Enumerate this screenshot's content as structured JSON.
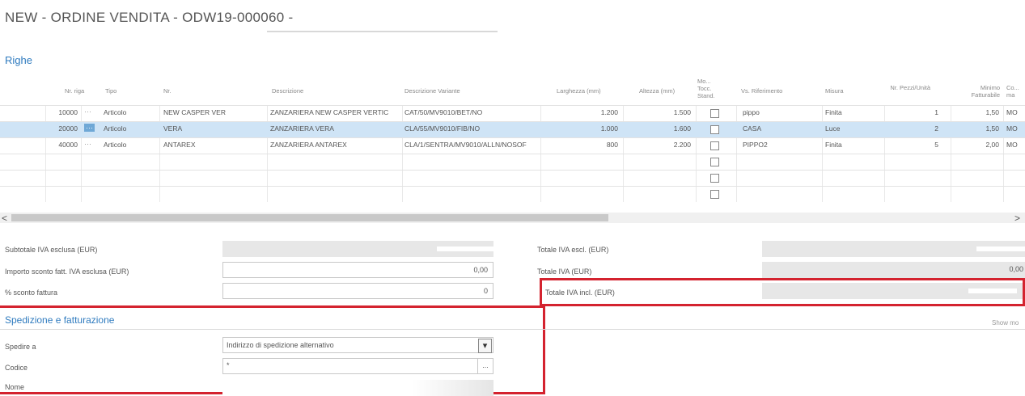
{
  "page_title": "NEW - ORDINE VENDITA - ODW19-000060 -",
  "section_righe": "Righe",
  "grid": {
    "headers": {
      "nr_riga": "Nr. riga",
      "tipo": "Tipo",
      "nr": "Nr.",
      "descrizione": "Descrizione",
      "descrizione_variante": "Descrizione Variante",
      "larghezza": "Larghezza (mm)",
      "altezza": "Altezza (mm)",
      "mo_tocc_stand": "Mo... Tocc. Stand.",
      "vs_riferimento": "Vs. Riferimento",
      "misura": "Misura",
      "nr_pezzi_unita": "Nr. Pezzi/Unità",
      "minimo_fatturabile": "Minimo Fatturabile",
      "co_ma": "Co... ma"
    },
    "rows": [
      {
        "nr_riga": "10000",
        "dots": "···",
        "tipo": "Articolo",
        "nr": "NEW CASPER VER",
        "descrizione": "ZANZARIERA NEW CASPER VERTIC",
        "descrizione_variante": "CAT/50/MV9010/BET/NO",
        "larghezza": "1.200",
        "altezza": "1.500",
        "vs_riferimento": "pippo",
        "misura": "Finita",
        "nr_pezzi": "1",
        "minimo": "1,50",
        "co": "MO"
      },
      {
        "nr_riga": "20000",
        "dots": "···",
        "tipo": "Articolo",
        "nr": "VERA",
        "descrizione": "ZANZARIERA VERA",
        "descrizione_variante": "CLA/55/MV9010/FIB/NO",
        "larghezza": "1.000",
        "altezza": "1.600",
        "vs_riferimento": "CASA",
        "misura": "Luce",
        "nr_pezzi": "2",
        "minimo": "1,50",
        "co": "MO"
      },
      {
        "nr_riga": "40000",
        "dots": "···",
        "tipo": "Articolo",
        "nr": "ANTAREX",
        "descrizione": "ZANZARIERA ANTAREX",
        "descrizione_variante": "CLA/1/SENTRA/MV9010/ALLN/NOSOF",
        "larghezza": "800",
        "altezza": "2.200",
        "vs_riferimento": "PIPPO2",
        "misura": "Finita",
        "nr_pezzi": "5",
        "minimo": "2,00",
        "co": "MO"
      }
    ]
  },
  "scroll": {
    "left_glyph": "<",
    "right_glyph": ">"
  },
  "totals": {
    "subtotale_label": "Subtotale IVA esclusa (EUR)",
    "importo_sconto_label": "Importo sconto fatt. IVA esclusa (EUR)",
    "importo_sconto_value": "0,00",
    "sconto_fattura_label": "% sconto fattura",
    "sconto_fattura_value": "0",
    "totale_esc_label": "Totale IVA escl. (EUR)",
    "totale_iva_label": "Totale IVA (EUR)",
    "totale_iva_value": "0,00",
    "totale_incl_label": "Totale IVA incl. (EUR)"
  },
  "shipping": {
    "section_title": "Spedizione e fatturazione",
    "show_more": "Show mo",
    "spedire_a_label": "Spedire a",
    "spedire_a_value": "Indirizzo di spedizione alternativo",
    "codice_label": "Codice",
    "codice_value": "*",
    "nome_label": "Nome",
    "codice_lookup": "...",
    "dropdown_glyph": "▾"
  },
  "colors": {
    "accent": "#2f7bbf",
    "highlight_red": "#d4232f",
    "selected_row": "#cfe4f6"
  }
}
